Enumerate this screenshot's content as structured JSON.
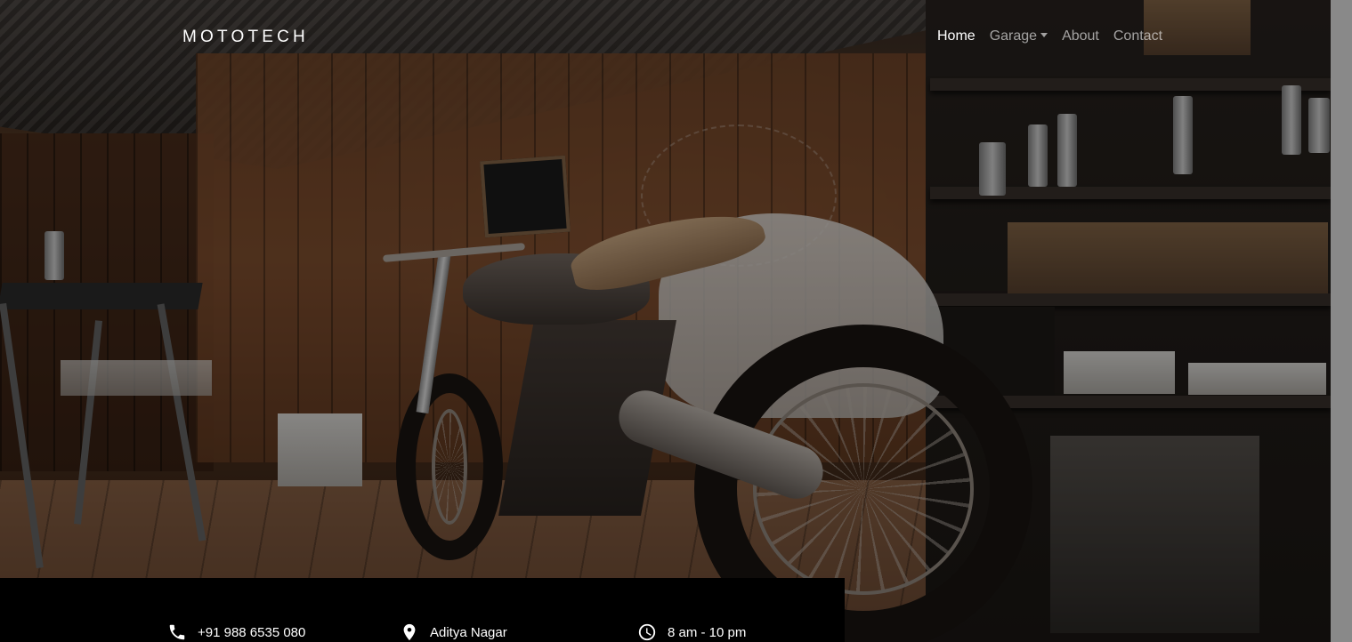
{
  "brand": "MOTOTECH",
  "nav": {
    "home": "Home",
    "garage": "Garage",
    "about": "About",
    "contact": "Contact"
  },
  "info": {
    "phone": {
      "icon": "phone-icon",
      "text": "+91 988 6535 080"
    },
    "location": {
      "icon": "map-pin-icon",
      "text": "Aditya Nagar"
    },
    "hours": {
      "icon": "clock-icon",
      "text": "8 am - 10 pm"
    }
  },
  "hero": {
    "image": "motorcycle-garage-background",
    "overlay_color": "#000000"
  }
}
